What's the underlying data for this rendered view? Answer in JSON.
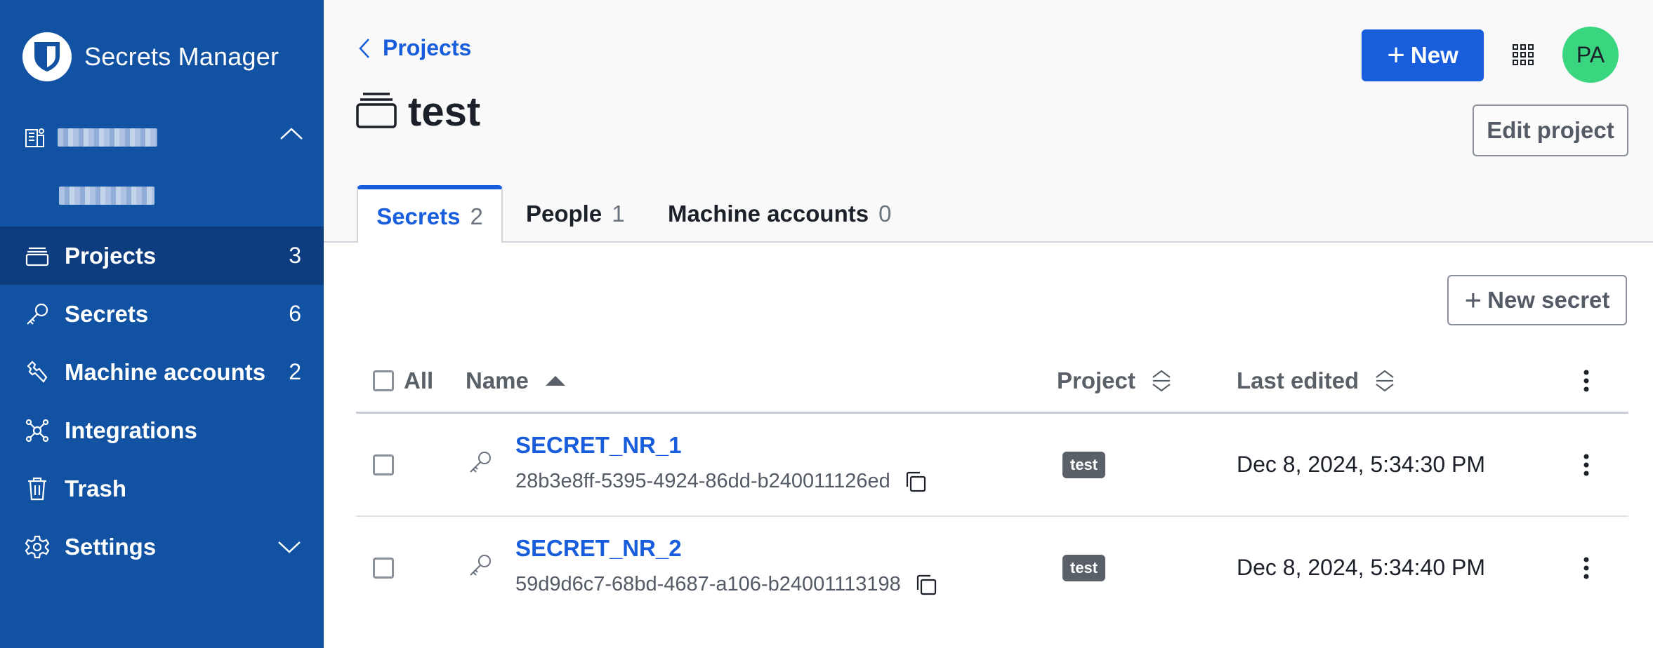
{
  "brand": {
    "name": "Secrets Manager"
  },
  "sidebar": {
    "items": [
      {
        "label": "Projects",
        "count": "3"
      },
      {
        "label": "Secrets",
        "count": "6"
      },
      {
        "label": "Machine accounts",
        "count": "2"
      },
      {
        "label": "Integrations"
      },
      {
        "label": "Trash"
      },
      {
        "label": "Settings"
      }
    ],
    "active_item": "Projects"
  },
  "header": {
    "breadcrumb": "Projects",
    "title": "test",
    "new_button": "New",
    "edit_button": "Edit project",
    "avatar_initials": "PA"
  },
  "tabs": [
    {
      "label": "Secrets",
      "count": "2"
    },
    {
      "label": "People",
      "count": "1"
    },
    {
      "label": "Machine accounts",
      "count": "0"
    }
  ],
  "toolbar": {
    "new_secret": "New secret"
  },
  "table": {
    "columns": {
      "all": "All",
      "name": "Name",
      "project": "Project",
      "last_edited": "Last edited"
    },
    "rows": [
      {
        "name": "SECRET_NR_1",
        "id": "28b3e8ff-5395-4924-86dd-b240011126ed",
        "project": "test",
        "last_edited": "Dec 8, 2024, 5:34:30 PM"
      },
      {
        "name": "SECRET_NR_2",
        "id": "59d9d6c7-68bd-4687-a106-b24001113198",
        "project": "test",
        "last_edited": "Dec 8, 2024, 5:34:40 PM"
      }
    ]
  },
  "colors": {
    "primary": "#175ddc",
    "sidebar": "#1252a3",
    "sidebar_active": "#0e3d7f",
    "avatar": "#3ad67f",
    "badge": "#5a6068"
  }
}
